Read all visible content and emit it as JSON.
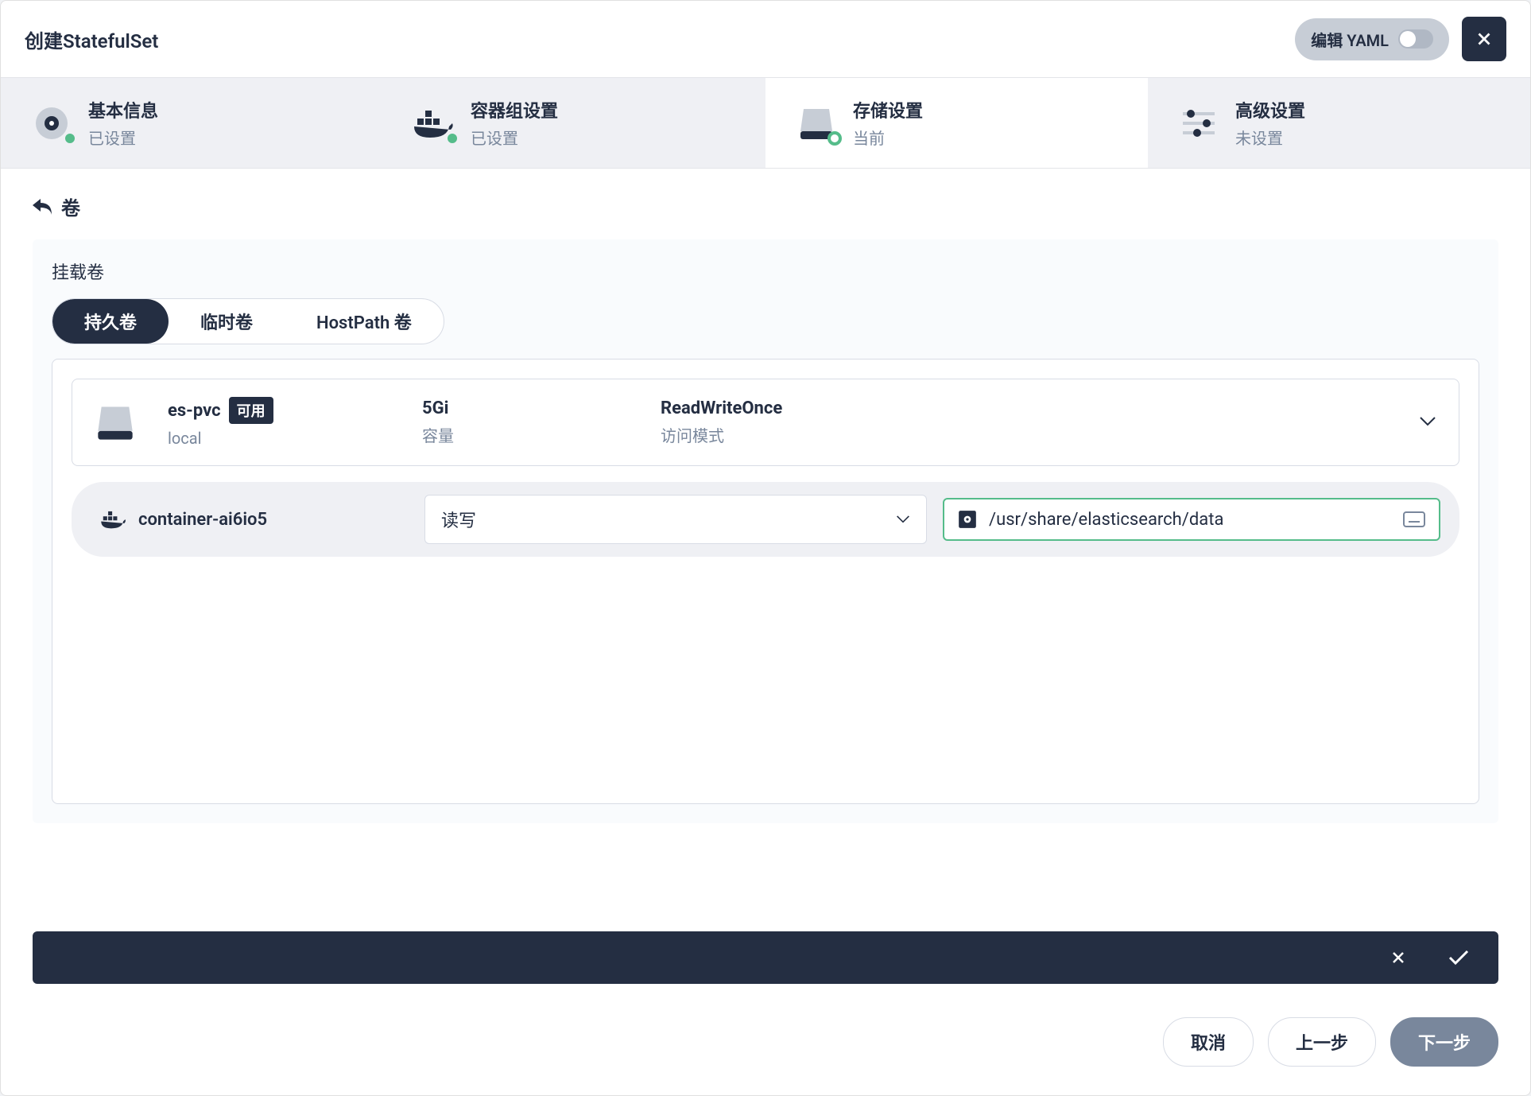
{
  "header": {
    "title": "创建StatefulSet",
    "yaml_label": "编辑 YAML"
  },
  "steps": [
    {
      "title": "基本信息",
      "sub": "已设置"
    },
    {
      "title": "容器组设置",
      "sub": "已设置"
    },
    {
      "title": "存储设置",
      "sub": "当前"
    },
    {
      "title": "高级设置",
      "sub": "未设置"
    }
  ],
  "content": {
    "back_title": "卷",
    "section_label": "挂载卷",
    "tabs": [
      "持久卷",
      "临时卷",
      "HostPath 卷"
    ],
    "pvc": {
      "name": "es-pvc",
      "status": "可用",
      "storage_class": "local",
      "size": "5Gi",
      "size_label": "容量",
      "mode": "ReadWriteOnce",
      "mode_label": "访问模式"
    },
    "mount": {
      "container": "container-ai6io5",
      "access": "读写",
      "path": "/usr/share/elasticsearch/data"
    }
  },
  "footer": {
    "cancel": "取消",
    "prev": "上一步",
    "next": "下一步"
  }
}
